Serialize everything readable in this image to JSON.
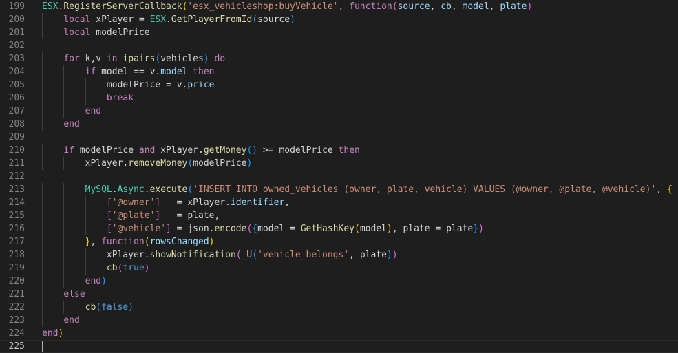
{
  "editor": {
    "language": "lua",
    "cursor_line": "225",
    "lines": [
      {
        "n": "199",
        "indent": 0,
        "tokens": [
          [
            "ESX",
            "esx"
          ],
          [
            ".",
            "op"
          ],
          [
            "RegisterServerCallback",
            "fn"
          ],
          [
            "(",
            "br1"
          ],
          [
            "'esx_vehicleshop:buyVehicle'",
            "str"
          ],
          [
            ", ",
            "op"
          ],
          [
            "function",
            "kw"
          ],
          [
            "(",
            "br2"
          ],
          [
            "source",
            "par"
          ],
          [
            ", ",
            "op"
          ],
          [
            "cb",
            "par"
          ],
          [
            ", ",
            "op"
          ],
          [
            "model",
            "par"
          ],
          [
            ", ",
            "op"
          ],
          [
            "plate",
            "par"
          ],
          [
            ")",
            "br2"
          ]
        ]
      },
      {
        "n": "200",
        "indent": 1,
        "tokens": [
          [
            "local ",
            "kw"
          ],
          [
            "xPlayer",
            "id"
          ],
          [
            " = ",
            "op"
          ],
          [
            "ESX",
            "esx"
          ],
          [
            ".",
            "op"
          ],
          [
            "GetPlayerFromId",
            "fn"
          ],
          [
            "(",
            "br3"
          ],
          [
            "source",
            "id"
          ],
          [
            ")",
            "br3"
          ]
        ]
      },
      {
        "n": "201",
        "indent": 1,
        "tokens": [
          [
            "local ",
            "kw"
          ],
          [
            "modelPrice",
            "id"
          ]
        ]
      },
      {
        "n": "202",
        "indent": 0,
        "tokens": []
      },
      {
        "n": "203",
        "indent": 1,
        "tokens": [
          [
            "for ",
            "kw"
          ],
          [
            "k",
            "id"
          ],
          [
            ",",
            "op"
          ],
          [
            "v",
            "id"
          ],
          [
            " in ",
            "kw"
          ],
          [
            "ipairs",
            "fn"
          ],
          [
            "(",
            "br3"
          ],
          [
            "vehicles",
            "id"
          ],
          [
            ")",
            "br3"
          ],
          [
            " do",
            "kw"
          ]
        ]
      },
      {
        "n": "204",
        "indent": 2,
        "tokens": [
          [
            "if ",
            "kw"
          ],
          [
            "model",
            "id"
          ],
          [
            " == ",
            "op"
          ],
          [
            "v",
            "id"
          ],
          [
            ".",
            "op"
          ],
          [
            "model",
            "field"
          ],
          [
            " then",
            "kw"
          ]
        ]
      },
      {
        "n": "205",
        "indent": 3,
        "tokens": [
          [
            "modelPrice",
            "id"
          ],
          [
            " = ",
            "op"
          ],
          [
            "v",
            "id"
          ],
          [
            ".",
            "op"
          ],
          [
            "price",
            "field"
          ]
        ]
      },
      {
        "n": "206",
        "indent": 3,
        "tokens": [
          [
            "break",
            "kw"
          ]
        ]
      },
      {
        "n": "207",
        "indent": 2,
        "tokens": [
          [
            "end",
            "kw"
          ]
        ]
      },
      {
        "n": "208",
        "indent": 1,
        "tokens": [
          [
            "end",
            "kw"
          ]
        ]
      },
      {
        "n": "209",
        "indent": 0,
        "tokens": []
      },
      {
        "n": "210",
        "indent": 1,
        "tokens": [
          [
            "if ",
            "kw"
          ],
          [
            "modelPrice",
            "id"
          ],
          [
            " and ",
            "kw"
          ],
          [
            "xPlayer",
            "id"
          ],
          [
            ".",
            "op"
          ],
          [
            "getMoney",
            "fn"
          ],
          [
            "()",
            "br3"
          ],
          [
            " >= ",
            "op"
          ],
          [
            "modelPrice",
            "id"
          ],
          [
            " then",
            "kw"
          ]
        ]
      },
      {
        "n": "211",
        "indent": 2,
        "tokens": [
          [
            "xPlayer",
            "id"
          ],
          [
            ".",
            "op"
          ],
          [
            "removeMoney",
            "fn"
          ],
          [
            "(",
            "br3"
          ],
          [
            "modelPrice",
            "id"
          ],
          [
            ")",
            "br3"
          ]
        ]
      },
      {
        "n": "212",
        "indent": 0,
        "tokens": []
      },
      {
        "n": "213",
        "indent": 2,
        "tokens": [
          [
            "MySQL",
            "esx"
          ],
          [
            ".",
            "op"
          ],
          [
            "Async",
            "esx"
          ],
          [
            ".",
            "op"
          ],
          [
            "execute",
            "fn"
          ],
          [
            "(",
            "br3"
          ],
          [
            "'INSERT INTO owned_vehicles (owner, plate, vehicle) VALUES (@owner, @plate, @vehicle)'",
            "str"
          ],
          [
            ", ",
            "op"
          ],
          [
            "{",
            "br1"
          ]
        ]
      },
      {
        "n": "214",
        "indent": 3,
        "tokens": [
          [
            "[",
            "br2"
          ],
          [
            "'@owner'",
            "str"
          ],
          [
            "]",
            "br2"
          ],
          [
            "   = ",
            "op"
          ],
          [
            "xPlayer",
            "id"
          ],
          [
            ".",
            "op"
          ],
          [
            "identifier",
            "field"
          ],
          [
            ",",
            "op"
          ]
        ]
      },
      {
        "n": "215",
        "indent": 3,
        "tokens": [
          [
            "[",
            "br2"
          ],
          [
            "'@plate'",
            "str"
          ],
          [
            "]",
            "br2"
          ],
          [
            "   = ",
            "op"
          ],
          [
            "plate",
            "id"
          ],
          [
            ",",
            "op"
          ]
        ]
      },
      {
        "n": "216",
        "indent": 3,
        "tokens": [
          [
            "[",
            "br2"
          ],
          [
            "'@vehicle'",
            "str"
          ],
          [
            "]",
            "br2"
          ],
          [
            " = ",
            "op"
          ],
          [
            "json",
            "id"
          ],
          [
            ".",
            "op"
          ],
          [
            "encode",
            "fn"
          ],
          [
            "(",
            "br2"
          ],
          [
            "{",
            "br3"
          ],
          [
            "model",
            "id"
          ],
          [
            " = ",
            "op"
          ],
          [
            "GetHashKey",
            "fn"
          ],
          [
            "(",
            "br1"
          ],
          [
            "model",
            "id"
          ],
          [
            ")",
            "br1"
          ],
          [
            ", ",
            "op"
          ],
          [
            "plate",
            "id"
          ],
          [
            " = ",
            "op"
          ],
          [
            "plate",
            "id"
          ],
          [
            "}",
            "br3"
          ],
          [
            ")",
            "br2"
          ]
        ]
      },
      {
        "n": "217",
        "indent": 2,
        "tokens": [
          [
            "}",
            "br1"
          ],
          [
            ", ",
            "op"
          ],
          [
            "function",
            "kw"
          ],
          [
            "(",
            "br1"
          ],
          [
            "rowsChanged",
            "par"
          ],
          [
            ")",
            "br1"
          ]
        ]
      },
      {
        "n": "218",
        "indent": 3,
        "tokens": [
          [
            "xPlayer",
            "id"
          ],
          [
            ".",
            "op"
          ],
          [
            "showNotification",
            "fn"
          ],
          [
            "(",
            "br2"
          ],
          [
            "_U",
            "fn"
          ],
          [
            "(",
            "br3"
          ],
          [
            "'vehicle_belongs'",
            "str"
          ],
          [
            ", ",
            "op"
          ],
          [
            "plate",
            "id"
          ],
          [
            ")",
            "br3"
          ],
          [
            ")",
            "br2"
          ]
        ]
      },
      {
        "n": "219",
        "indent": 3,
        "tokens": [
          [
            "cb",
            "fn"
          ],
          [
            "(",
            "br2"
          ],
          [
            "true",
            "kwb"
          ],
          [
            ")",
            "br2"
          ]
        ]
      },
      {
        "n": "220",
        "indent": 2,
        "tokens": [
          [
            "end",
            "kw"
          ],
          [
            ")",
            "br3"
          ]
        ]
      },
      {
        "n": "221",
        "indent": 1,
        "tokens": [
          [
            "else",
            "kw"
          ]
        ]
      },
      {
        "n": "222",
        "indent": 2,
        "tokens": [
          [
            "cb",
            "fn"
          ],
          [
            "(",
            "br3"
          ],
          [
            "false",
            "kwb"
          ],
          [
            ")",
            "br3"
          ]
        ]
      },
      {
        "n": "223",
        "indent": 1,
        "tokens": [
          [
            "end",
            "kw"
          ]
        ]
      },
      {
        "n": "224",
        "indent": 0,
        "tokens": [
          [
            "end",
            "kw"
          ],
          [
            ")",
            "br1"
          ]
        ]
      },
      {
        "n": "225",
        "indent": 0,
        "tokens": []
      }
    ]
  }
}
